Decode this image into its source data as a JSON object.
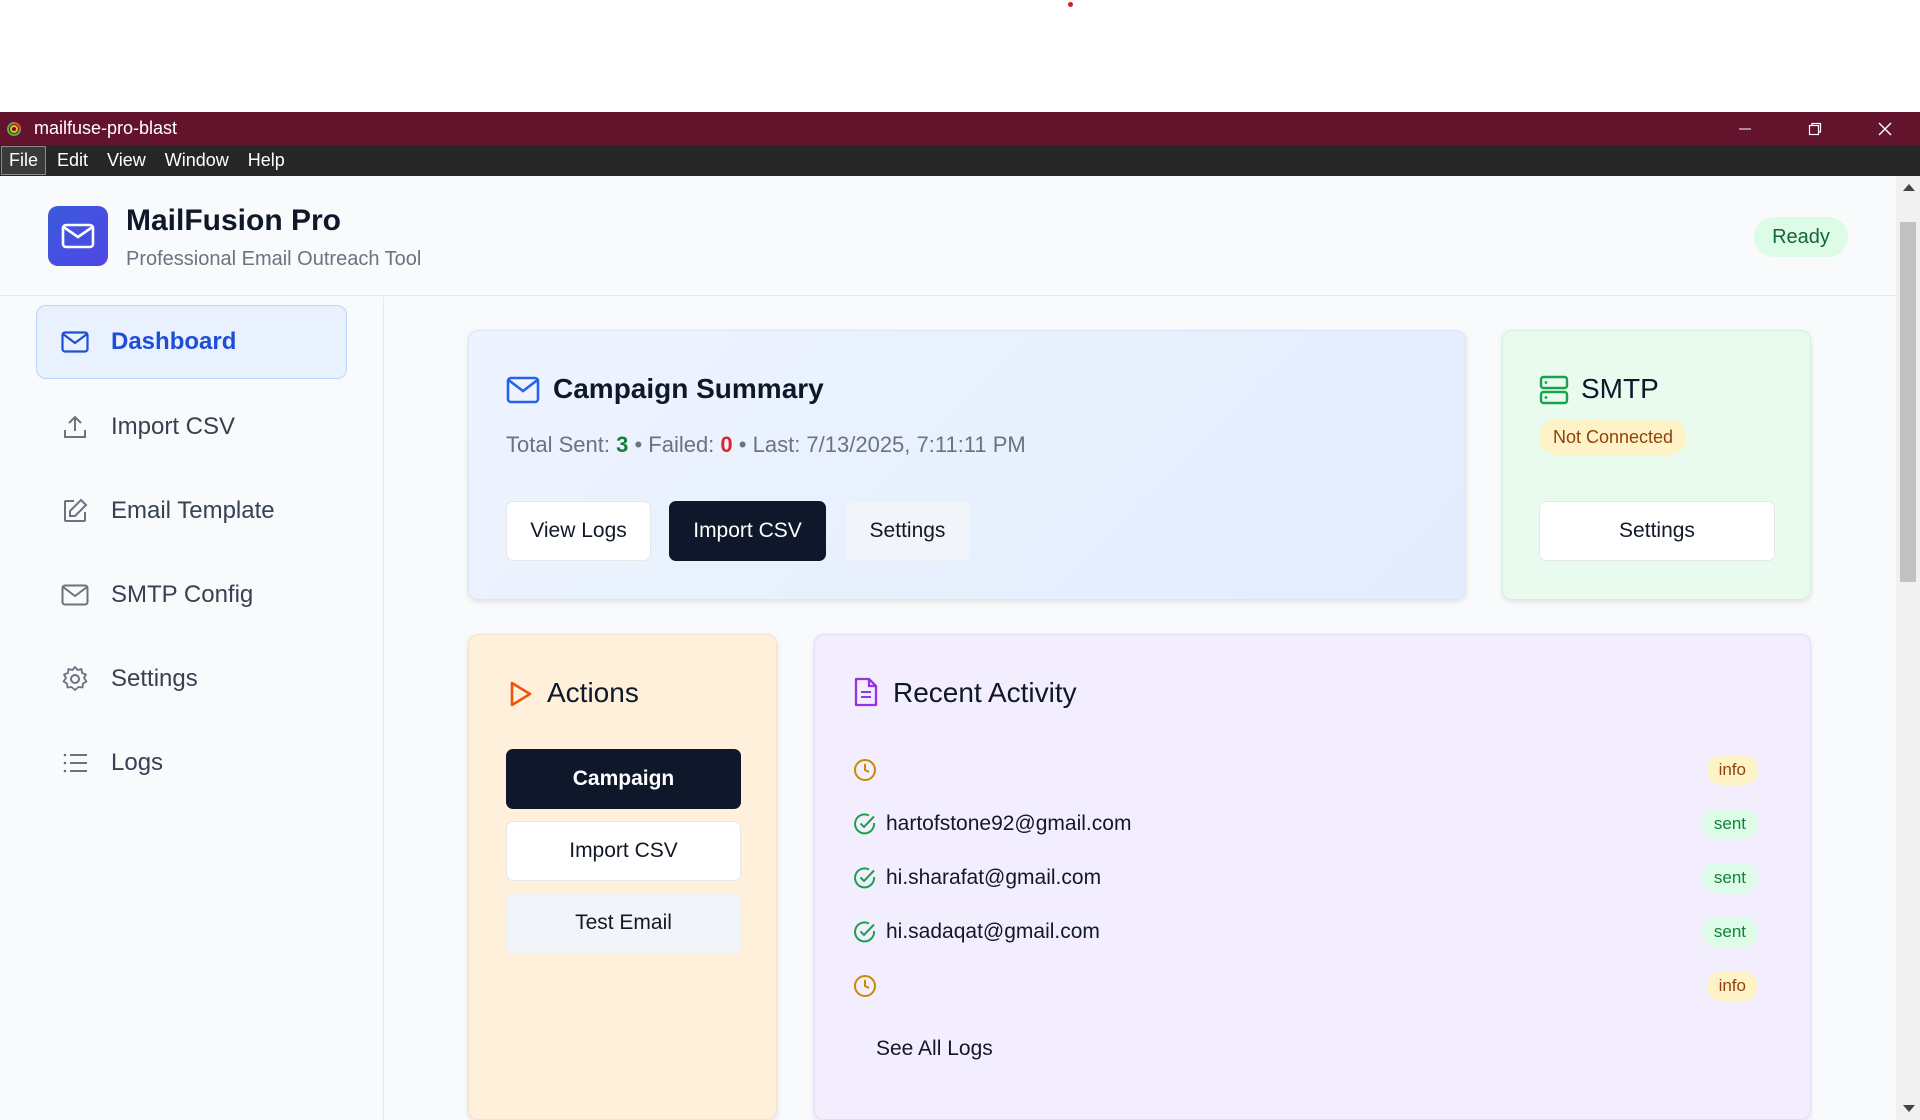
{
  "window": {
    "title": "mailfuse-pro-blast",
    "menu": [
      "File",
      "Edit",
      "View",
      "Window",
      "Help"
    ]
  },
  "header": {
    "app_name": "MailFusion Pro",
    "tagline": "Professional Email Outreach Tool",
    "status": "Ready"
  },
  "sidebar": {
    "items": [
      {
        "label": "Dashboard",
        "icon": "mail-icon"
      },
      {
        "label": "Import CSV",
        "icon": "upload-icon"
      },
      {
        "label": "Email Template",
        "icon": "edit-icon"
      },
      {
        "label": "SMTP Config",
        "icon": "mail-icon"
      },
      {
        "label": "Settings",
        "icon": "gear-icon"
      },
      {
        "label": "Logs",
        "icon": "list-icon"
      }
    ]
  },
  "summary": {
    "title": "Campaign Summary",
    "sent_label": "Total Sent: ",
    "sent_value": "3",
    "sep1": " • ",
    "failed_label": "Failed: ",
    "failed_value": "0",
    "sep2": " • ",
    "last_label": "Last: 7/13/2025, 7:11:11 PM",
    "buttons": {
      "view_logs": "View Logs",
      "import_csv": "Import CSV",
      "settings": "Settings"
    }
  },
  "smtp": {
    "title": "SMTP",
    "status": "Not Connected",
    "settings_button": "Settings"
  },
  "actions": {
    "title": "Actions",
    "campaign": "Campaign",
    "import_csv": "Import CSV",
    "test_email": "Test Email"
  },
  "activity": {
    "title": "Recent Activity",
    "rows": [
      {
        "email": "",
        "badge": "info",
        "icon": "clock-icon"
      },
      {
        "email": "hartofstone92@gmail.com",
        "badge": "sent",
        "icon": "check-circle-icon"
      },
      {
        "email": "hi.sharafat@gmail.com",
        "badge": "sent",
        "icon": "check-circle-icon"
      },
      {
        "email": "hi.sadaqat@gmail.com",
        "badge": "sent",
        "icon": "check-circle-icon"
      },
      {
        "email": "",
        "badge": "info",
        "icon": "clock-icon"
      }
    ],
    "see_all": "See All Logs"
  },
  "colors": {
    "titlebar": "#64132c",
    "accent_blue": "#1d4ed8",
    "dark_button": "#0f172a",
    "success_green": "#15803d",
    "danger_red": "#dc2626"
  }
}
